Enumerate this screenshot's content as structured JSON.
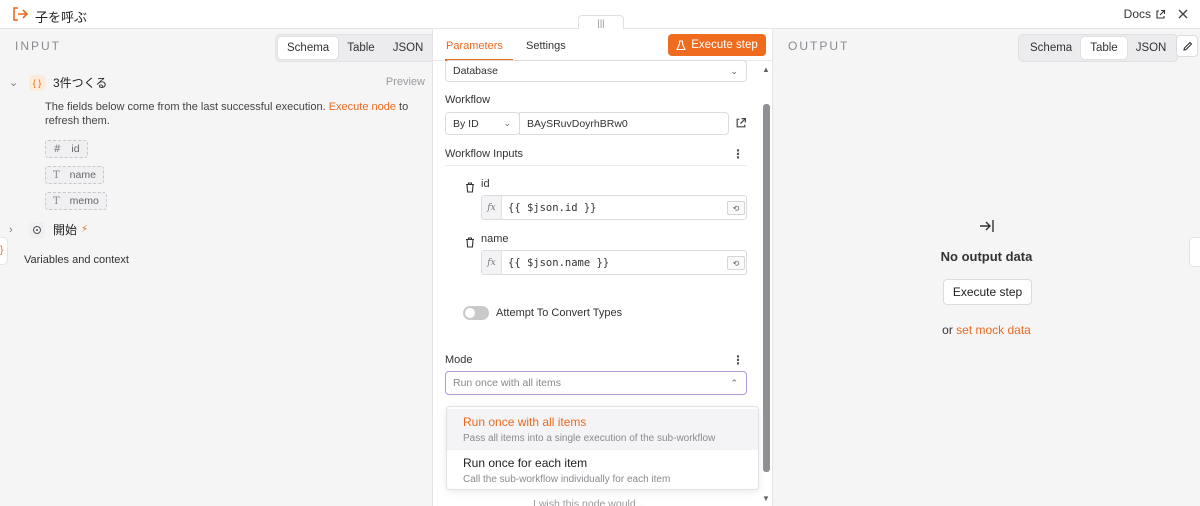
{
  "header": {
    "node_title": "子を呼ぶ",
    "docs_label": "Docs",
    "drag_handle": "|||"
  },
  "input": {
    "heading": "INPUT",
    "view_options": [
      "Schema",
      "Table",
      "JSON"
    ],
    "active_view": "Schema",
    "node1": {
      "badge": "{ }",
      "name": "3件つくる",
      "preview": "Preview"
    },
    "description_before": "The fields below come from the last successful execution.",
    "description_link": "Execute node",
    "description_after": "to refresh them.",
    "fields": [
      {
        "type_glyph": "#",
        "name": "id"
      },
      {
        "type_glyph": "T",
        "name": "name"
      },
      {
        "type_glyph": "T",
        "name": "memo"
      }
    ],
    "node2": {
      "name": "開始",
      "bolt": "⚡"
    },
    "edge_tab": "}",
    "variables_label": "Variables and context"
  },
  "parameters": {
    "tabs": [
      "Parameters",
      "Settings"
    ],
    "active_tab": "Parameters",
    "execute_step": "Execute step",
    "source_value": "Database",
    "workflow_label": "Workflow",
    "workflow_mode": "By ID",
    "workflow_id": "BAySRuvDoyrhBRw0",
    "workflow_inputs_label": "Workflow Inputs",
    "inputs": [
      {
        "name": "id",
        "expression": "{{ $json.id }}"
      },
      {
        "name": "name",
        "expression": "{{ $json.name }}"
      }
    ],
    "fx_label": "fx",
    "convert_types_label": "Attempt To Convert Types",
    "convert_types_on": false,
    "mode_label": "Mode",
    "mode_value": "Run once with all items",
    "mode_options": [
      {
        "title": "Run once with all items",
        "subtitle": "Pass all items into a single execution of the sub-workflow"
      },
      {
        "title": "Run once for each item",
        "subtitle": "Call the sub-workflow individually for each item"
      }
    ],
    "footer_faded": "I wish this node would..."
  },
  "output": {
    "heading": "OUTPUT",
    "view_options": [
      "Schema",
      "Table",
      "JSON"
    ],
    "active_view": "Table",
    "no_output": "No output data",
    "execute_step": "Execute step",
    "mock_prefix": "or",
    "mock_link": "set mock data"
  },
  "colors": {
    "accent": "#ea6a1f",
    "accent_button": "#ef6c1f"
  }
}
